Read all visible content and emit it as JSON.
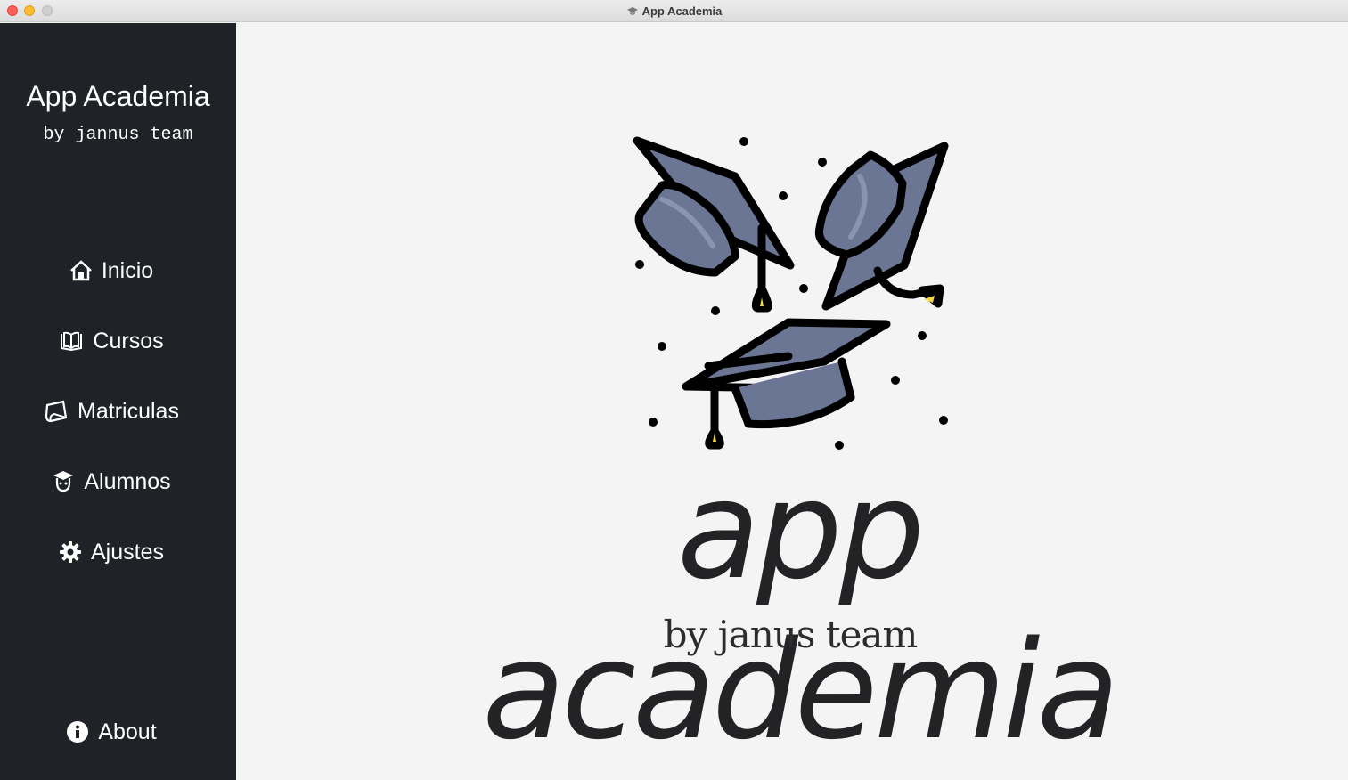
{
  "window": {
    "title": "App Academia"
  },
  "sidebar": {
    "brand_title": "App Academia",
    "brand_subtitle": "by jannus team",
    "items": [
      {
        "label": "Inicio",
        "icon": "home-icon"
      },
      {
        "label": "Cursos",
        "icon": "book-open-icon"
      },
      {
        "label": "Matriculas",
        "icon": "book-tilted-icon"
      },
      {
        "label": "Alumnos",
        "icon": "student-icon"
      },
      {
        "label": "Ajustes",
        "icon": "gear-icon"
      }
    ],
    "footer_item": {
      "label": "About",
      "icon": "info-circle-icon"
    }
  },
  "main": {
    "logo_wordmark": "app academia",
    "logo_byline": "by janus team",
    "logo_icon": "graduation-caps-illustration"
  },
  "colors": {
    "sidebar_bg": "#1f2227",
    "main_bg": "#f4f4f4",
    "cap_fill": "#6b7594",
    "tassel_accent": "#f5d84a"
  }
}
